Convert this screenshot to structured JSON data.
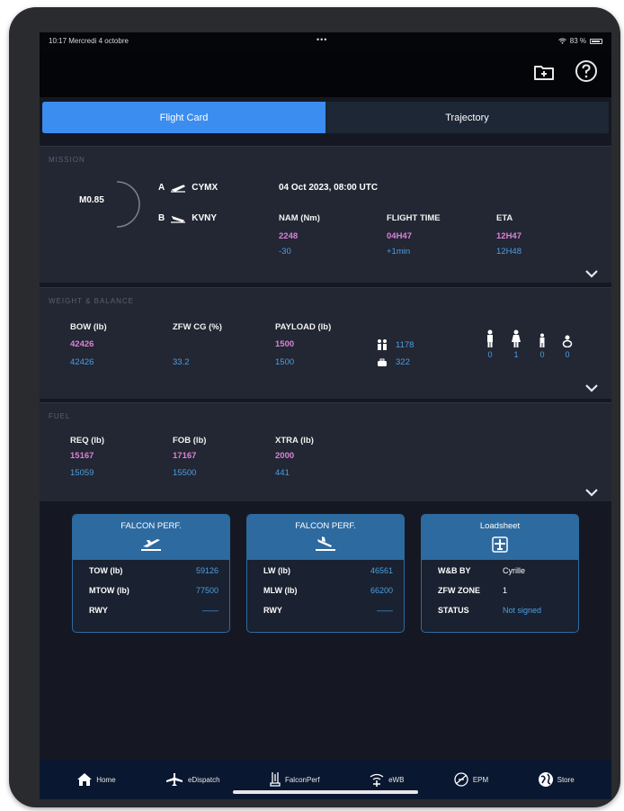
{
  "status_bar": {
    "time_date": "10:17  Mercredi 4 octobre",
    "dots": "•••",
    "battery": "83 %"
  },
  "tabs": [
    {
      "label": "Flight Card",
      "active": true
    },
    {
      "label": "Trajectory",
      "active": false
    }
  ],
  "mission": {
    "title": "MISSION",
    "mach": "M0.85",
    "departure_letter": "A",
    "departure": "CYMX",
    "arrival_letter": "B",
    "arrival": "KVNY",
    "datetime": "04 Oct 2023, 08:00 UTC",
    "nam_label": "NAM (Nm)",
    "nam_value": "2248",
    "nam_delta": "-30",
    "flight_time_label": "FLIGHT TIME",
    "flight_time_value": "04H47",
    "flight_time_delta": "+1min",
    "eta_label": "ETA",
    "eta_value": "12H47",
    "eta_alt": "12H48"
  },
  "weight_balance": {
    "title": "WEIGHT & BALANCE",
    "bow_label": "BOW (lb)",
    "bow_value": "42426",
    "bow_alt": "42426",
    "zfw_label": "ZFW CG (%)",
    "zfw_alt": "33.2",
    "payload_label": "PAYLOAD (lb)",
    "payload_value": "1500",
    "payload_alt": "1500",
    "pax_weight": "1178",
    "bag_weight": "322",
    "pax_counts": [
      "0",
      "1",
      "0",
      "0"
    ]
  },
  "fuel": {
    "title": "FUEL",
    "req_label": "REQ (lb)",
    "req_value": "15167",
    "req_alt": "15059",
    "fob_label": "FOB (lb)",
    "fob_value": "17167",
    "fob_alt": "15500",
    "xtra_label": "XTRA (lb)",
    "xtra_value": "2000",
    "xtra_alt": "441"
  },
  "cards": {
    "takeoff": {
      "title": "FALCON PERF.",
      "rows": [
        {
          "k": "TOW (lb)",
          "v": "59126"
        },
        {
          "k": "MTOW (lb)",
          "v": "77500"
        },
        {
          "k": "RWY",
          "v": "——"
        }
      ]
    },
    "landing": {
      "title": "FALCON PERF.",
      "rows": [
        {
          "k": "LW (lb)",
          "v": "46561"
        },
        {
          "k": "MLW (lb)",
          "v": "66200"
        },
        {
          "k": "RWY",
          "v": "——"
        }
      ]
    },
    "loadsheet": {
      "title": "Loadsheet",
      "rows": [
        {
          "k": "W&B BY",
          "v": "Cyrille"
        },
        {
          "k": "ZFW ZONE",
          "v": "1"
        },
        {
          "k": "STATUS",
          "v": "Not signed"
        }
      ]
    }
  },
  "bottom_nav": [
    {
      "label": "Home",
      "icon": "home-icon"
    },
    {
      "label": "eDispatch",
      "icon": "dispatch-icon"
    },
    {
      "label": "FalconPerf",
      "icon": "falconperf-icon"
    },
    {
      "label": "eWB",
      "icon": "ewb-icon"
    },
    {
      "label": "EPM",
      "icon": "epm-icon"
    },
    {
      "label": "Store",
      "icon": "store-icon"
    }
  ],
  "colors": {
    "accent": "#3b8df0",
    "value_pink": "#d883d6",
    "value_blue": "#4aa0e0",
    "card_blue": "#2d6aa0"
  }
}
